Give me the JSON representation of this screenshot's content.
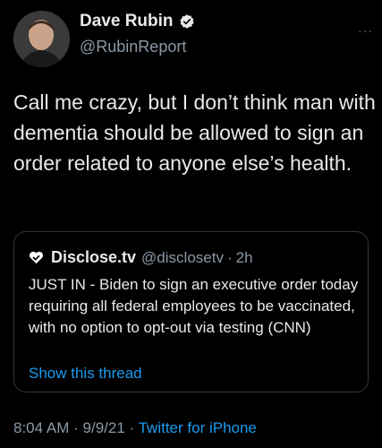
{
  "author": {
    "name": "Dave Rubin",
    "handle": "@RubinReport"
  },
  "more_label": "···",
  "tweet_text": "Call me crazy, but I don’t think man with dementia should be allowed to sign an order related to anyone else’s health.",
  "quoted": {
    "name": "Disclose.tv",
    "handle": "@disclosetv",
    "separator": "·",
    "time": "2h",
    "text": "JUST IN - Biden to sign an executive order today requiring all federal employees to be vaccinated, with no option to opt-out via testing (CNN)",
    "link": "Show this thread",
    "icon": "disclose-heart-icon"
  },
  "meta": {
    "time": "8:04 AM",
    "sep1": "·",
    "date": "9/9/21",
    "sep2": "·",
    "source": "Twitter for iPhone"
  },
  "colors": {
    "background": "#000000",
    "text": "#e7e9ea",
    "secondary": "#8b98a5",
    "link": "#1d9bf0",
    "verified": "#1d9bf0",
    "border": "#333639"
  }
}
